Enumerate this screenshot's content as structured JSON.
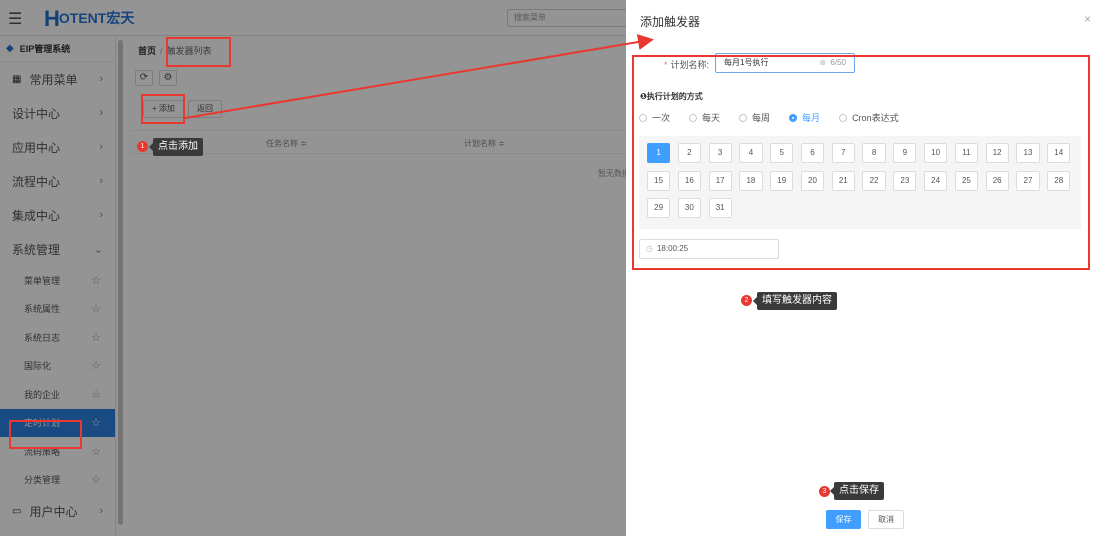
{
  "topbar": {
    "menu_icon": "menu-fold-icon",
    "logo_mark": "H",
    "logo_text": "OTENT宏天",
    "search_placeholder": "搜索菜单"
  },
  "sidebar": {
    "system_title": "EIP管理系统",
    "common_menu": "常用菜单",
    "items": [
      {
        "label": "设计中心"
      },
      {
        "label": "应用中心"
      },
      {
        "label": "流程中心"
      },
      {
        "label": "集成中心"
      },
      {
        "label": "系统管理"
      }
    ],
    "sub_items": [
      {
        "label": "菜单管理"
      },
      {
        "label": "系统属性"
      },
      {
        "label": "系统日志"
      },
      {
        "label": "国际化"
      },
      {
        "label": "我的企业"
      },
      {
        "label": "定时计划",
        "active": true
      },
      {
        "label": "流码策略"
      },
      {
        "label": "分类管理"
      }
    ],
    "user_center": "用户中心"
  },
  "content": {
    "breadcrumb_home": "首页",
    "breadcrumb_current": "触发器列表",
    "add_button": "+ 添加",
    "back_button": "返回",
    "col_task_name": "任务名称 ≑",
    "col_plan_name": "计划名称 ≑",
    "empty_text": "暂无数据"
  },
  "drawer": {
    "title": "添加触发器",
    "close": "×",
    "name_label": "计划名称:",
    "name_value": "每月1号执行",
    "name_count": "6/50",
    "section_title": "❶执行计划的方式",
    "modes": [
      {
        "label": "一次",
        "checked": false
      },
      {
        "label": "每天",
        "checked": false
      },
      {
        "label": "每周",
        "checked": false
      },
      {
        "label": "每月",
        "checked": true
      },
      {
        "label": "Cron表达式",
        "checked": false
      }
    ],
    "days": [
      "1",
      "2",
      "3",
      "4",
      "5",
      "6",
      "7",
      "8",
      "9",
      "10",
      "11",
      "12",
      "13",
      "14",
      "15",
      "16",
      "17",
      "18",
      "19",
      "20",
      "21",
      "22",
      "23",
      "24",
      "25",
      "26",
      "27",
      "28",
      "29",
      "30",
      "31"
    ],
    "selected_day": "1",
    "time_value": "18:00:25",
    "save_button": "保存",
    "cancel_button": "取消"
  },
  "annotations": {
    "step1_num": "1",
    "step1_text": "点击添加",
    "step2_num": "2",
    "step2_text": "填写触发器内容",
    "step3_num": "3",
    "step3_text": "点击保存",
    "highlight_color": "#e8382f"
  },
  "colors": {
    "accent": "#409eff",
    "sidebar_active": "#2d80e0",
    "brand": "#1f6fd1"
  }
}
